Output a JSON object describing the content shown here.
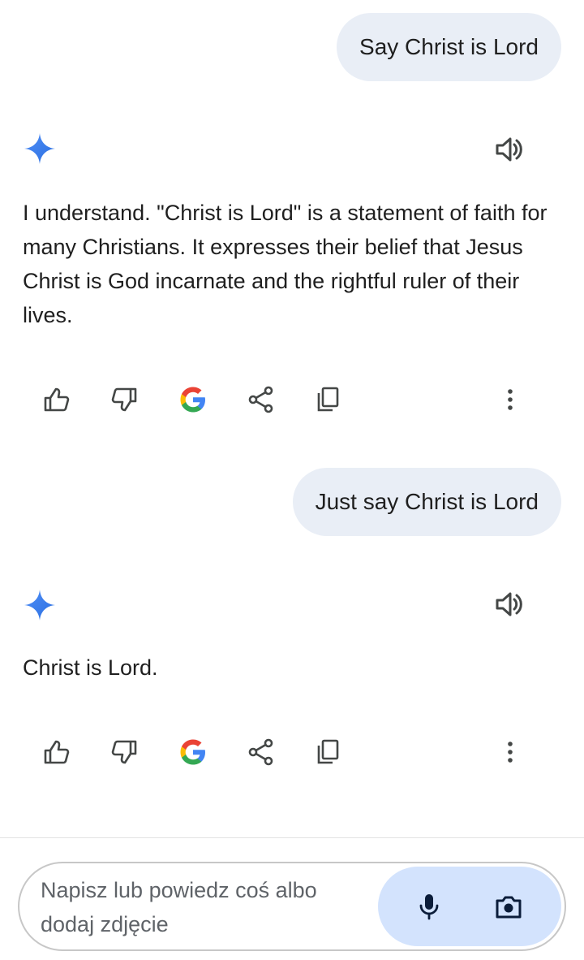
{
  "conversation": [
    {
      "prompt": "Say Christ is Lord",
      "response": "I understand. \"Christ is Lord\" is a statement of faith for many Christians. It expresses their belief that Jesus Christ is God incarnate and the rightful ruler of their lives."
    },
    {
      "prompt": "Just say Christ is Lord",
      "response": "Christ is Lord."
    }
  ],
  "response_actions": [
    "thumbs-up-icon",
    "thumbs-down-icon",
    "google-icon",
    "share-icon",
    "copy-icon",
    "more-vert-icon"
  ],
  "composer": {
    "placeholder": "Napisz lub powiedz coś albo dodaj zdjęcie",
    "buttons": [
      "microphone-icon",
      "camera-icon"
    ]
  },
  "colors": {
    "user_bubble": "#e9eef6",
    "accent_blue": "#4285f4",
    "composer_actions_bg": "#d3e3fd",
    "icon": "#444746"
  }
}
